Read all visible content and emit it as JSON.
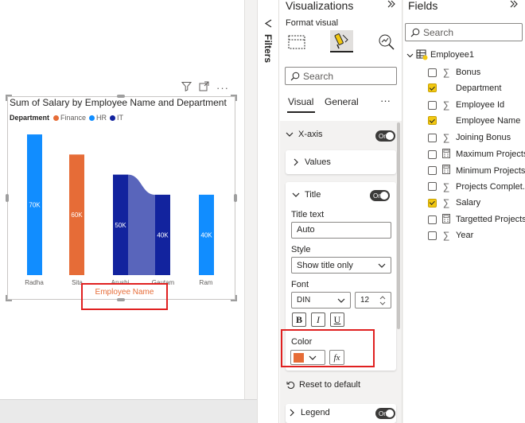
{
  "chart_data": {
    "type": "bar",
    "title": "Sum of Salary by Employee Name and Department",
    "legend_title": "Department",
    "legend_placement": "top-left",
    "series": [
      {
        "name": "Finance",
        "color": "#e66c37"
      },
      {
        "name": "HR",
        "color": "#118dff"
      },
      {
        "name": "IT",
        "color": "#12239e"
      }
    ],
    "categories": [
      "Radha",
      "Sita",
      "Arushi",
      "Gautam",
      "Ram"
    ],
    "bars": [
      {
        "category": "Radha",
        "series": "HR",
        "value": 70000,
        "label": "70K"
      },
      {
        "category": "Sita",
        "series": "Finance",
        "value": 60000,
        "label": "60K"
      },
      {
        "category": "Arushi",
        "series": "IT",
        "value": 50000,
        "label": "50K"
      },
      {
        "category": "Gautam",
        "series": "IT",
        "value": 40000,
        "label": "40K"
      },
      {
        "category": "Ram",
        "series": "HR",
        "value": 40000,
        "label": "40K"
      }
    ],
    "xlabel": "Employee Name",
    "xlabel_color": "#e66c37",
    "ylabel": "",
    "ylim": [
      0,
      72000
    ],
    "grid": false
  },
  "filters": {
    "label": "Filters"
  },
  "visualizations": {
    "title": "Visualizations",
    "format_visual_label": "Format visual",
    "search_placeholder": "Search",
    "tabs": {
      "visual": "Visual",
      "general": "General"
    },
    "xaxis": {
      "label": "X-axis",
      "toggle": "On"
    },
    "values": {
      "label": "Values"
    },
    "title_card": {
      "label": "Title",
      "toggle": "On",
      "title_text_label": "Title text",
      "title_text_value": "Auto",
      "style_label": "Style",
      "style_value": "Show title only",
      "font_label": "Font",
      "font_value": "DIN",
      "font_size": "12",
      "bold": "B",
      "italic": "I",
      "underline": "U",
      "color_label": "Color",
      "color_value": "#e66c37",
      "fx": "fx"
    },
    "reset_label": "Reset to default",
    "legend": {
      "label": "Legend",
      "toggle": "On"
    }
  },
  "fields": {
    "title": "Fields",
    "search_placeholder": "Search",
    "table_name": "Employee1",
    "items": [
      {
        "label": "Bonus",
        "checked": false,
        "icon": "sigma-icon"
      },
      {
        "label": "Department",
        "checked": true,
        "icon": ""
      },
      {
        "label": "Employee Id",
        "checked": false,
        "icon": "sigma-icon"
      },
      {
        "label": "Employee Name",
        "checked": true,
        "icon": ""
      },
      {
        "label": "Joining Bonus",
        "checked": false,
        "icon": "sigma-icon"
      },
      {
        "label": "Maximum Projects",
        "checked": false,
        "icon": "calculator-icon"
      },
      {
        "label": "Minimum Projects",
        "checked": false,
        "icon": "calculator-icon"
      },
      {
        "label": "Projects Complet...",
        "checked": false,
        "icon": "sigma-icon"
      },
      {
        "label": "Salary",
        "checked": true,
        "icon": "sigma-icon"
      },
      {
        "label": "Targetted Projects",
        "checked": false,
        "icon": "calculator-icon"
      },
      {
        "label": "Year",
        "checked": false,
        "icon": "sigma-icon"
      }
    ]
  }
}
